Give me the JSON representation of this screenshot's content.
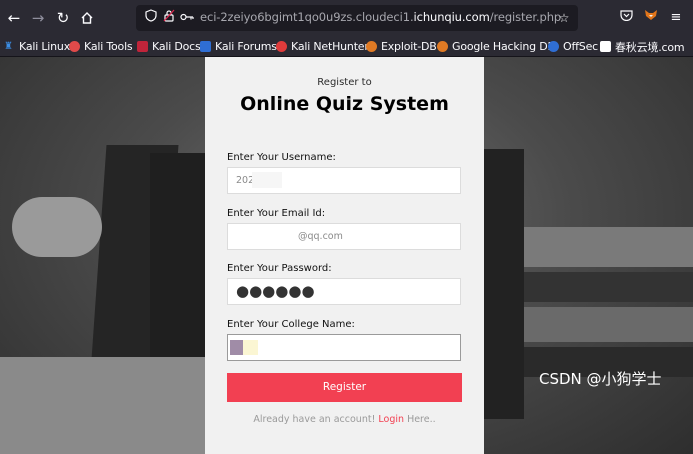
{
  "browser": {
    "url_prefix": "eci-2zeiyo6bgimt1qo0u9zs.cloudeci1.",
    "url_host": "ichunqiu.com",
    "url_path": "/register.php"
  },
  "bookmarks": [
    {
      "label": "Kali Linux",
      "icon_color": "#3b8ee6"
    },
    {
      "label": "Kali Tools",
      "icon_color": "#e04a4a"
    },
    {
      "label": "Kali Docs",
      "icon_color": "#c0243a"
    },
    {
      "label": "Kali Forums",
      "icon_color": "#2f6ed4"
    },
    {
      "label": "Kali NetHunter",
      "icon_color": "#e03b3b"
    },
    {
      "label": "Exploit-DB",
      "icon_color": "#e07a24"
    },
    {
      "label": "Google Hacking DB",
      "icon_color": "#e07a24"
    },
    {
      "label": "OffSec",
      "icon_color": "#2f6ed4"
    },
    {
      "label": "春秋云境.com",
      "icon_color": "#ffffff"
    }
  ],
  "form": {
    "subtitle": "Register to",
    "title": "Online Quiz System",
    "username_label": "Enter Your Username:",
    "username_value": "202",
    "email_label": "Enter Your Email Id:",
    "email_value": "@qq.com",
    "password_label": "Enter Your Password:",
    "password_value": "●●●●●●",
    "college_label": "Enter Your College Name:",
    "submit_label": "Register",
    "footer_prefix": "Already have an account! ",
    "footer_link": "Login",
    "footer_suffix": " Here.."
  },
  "watermark": "CSDN @小狗学士"
}
